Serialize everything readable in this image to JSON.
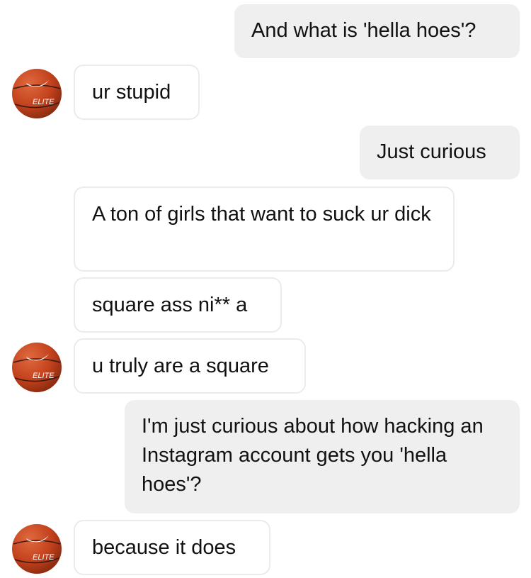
{
  "conversation": {
    "messages": [
      {
        "sender": "me",
        "text": "And what is 'hella hoes'?"
      },
      {
        "sender": "other",
        "text": "ur stupid"
      },
      {
        "sender": "me",
        "text": "Just curious"
      },
      {
        "sender": "other",
        "text": "A ton of girls that want to suck ur dick"
      },
      {
        "sender": "other",
        "text": "square ass ni** a"
      },
      {
        "sender": "other",
        "text": "u truly are a square"
      },
      {
        "sender": "me",
        "text": "I'm just curious about how hacking an Instagram account gets you 'hella hoes'?"
      },
      {
        "sender": "other",
        "text": "because it does"
      }
    ],
    "avatar": {
      "icon": "basketball-avatar-icon",
      "ball_color": "#c2421d",
      "logo_text": "ELITE"
    },
    "colors": {
      "outgoing_bubble": "#efefef",
      "incoming_border": "#ebebeb"
    }
  }
}
